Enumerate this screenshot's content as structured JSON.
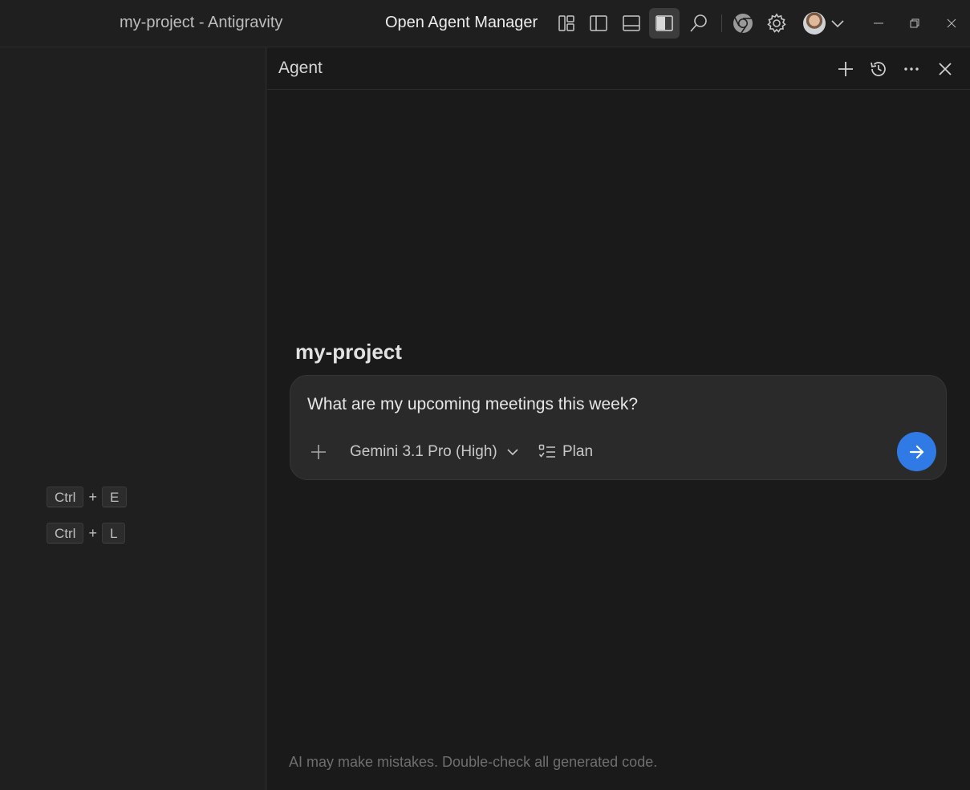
{
  "titlebar": {
    "window_title": "my-project - Antigravity",
    "open_agent_manager_label": "Open Agent Manager",
    "icons": [
      "customize-layout-icon",
      "toggle-primary-sidebar-icon",
      "toggle-panel-icon",
      "toggle-secondary-sidebar-icon",
      "search-icon",
      "chrome-icon",
      "settings-gear-icon",
      "account-avatar",
      "chevron-down-icon"
    ],
    "window_controls": [
      "minimize-icon",
      "restore-icon",
      "close-icon"
    ]
  },
  "left_pane": {
    "shortcuts": [
      {
        "modifier": "Ctrl",
        "plus": "+",
        "key": "E"
      },
      {
        "modifier": "Ctrl",
        "plus": "+",
        "key": "L"
      }
    ]
  },
  "agent_panel": {
    "title": "Agent",
    "header_icons": [
      "plus-icon",
      "history-icon",
      "more-icon",
      "close-icon"
    ],
    "project_name": "my-project",
    "composer": {
      "input_value": "What are my upcoming meetings this week?",
      "model": "Gemini 3.1 Pro (High)",
      "mode": "Plan"
    },
    "disclaimer": "AI may make mistakes. Double-check all generated code."
  },
  "colors": {
    "accent": "#2f7ae5",
    "background": "#1f1f1f",
    "panel_background": "#1a1a1a",
    "composer_background": "#2a2a2a"
  }
}
